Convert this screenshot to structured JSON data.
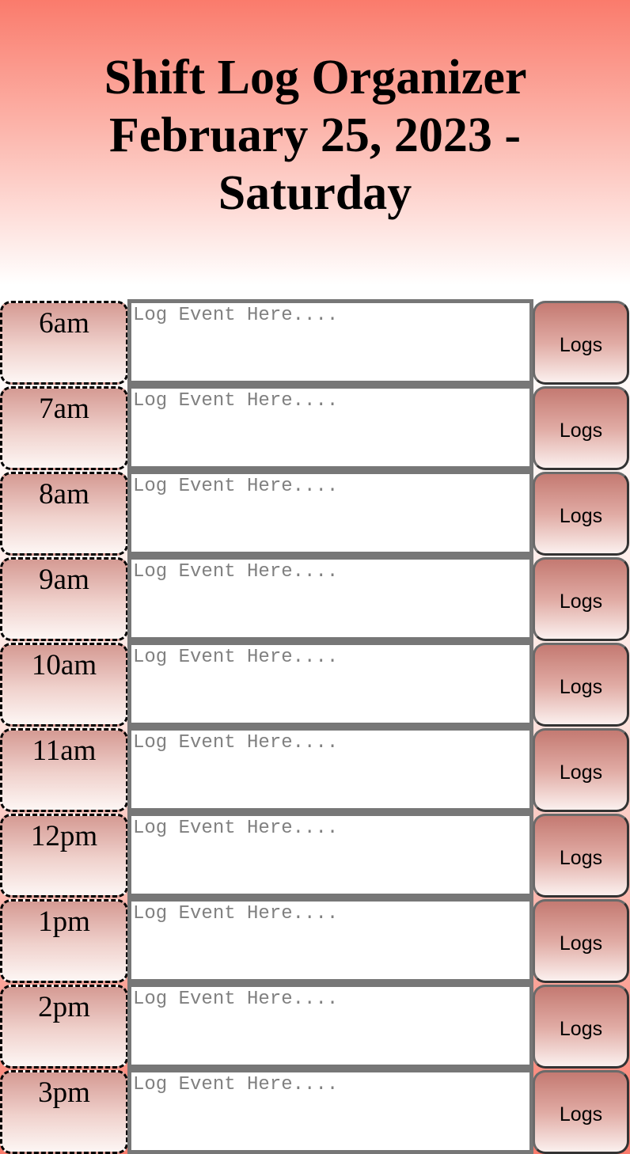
{
  "header": {
    "title": "Shift Log Organizer",
    "date": "February 25, 2023 - Saturday"
  },
  "rows": [
    {
      "hour": "6am",
      "placeholder": "Log Event Here....",
      "button": "Logs"
    },
    {
      "hour": "7am",
      "placeholder": "Log Event Here....",
      "button": "Logs"
    },
    {
      "hour": "8am",
      "placeholder": "Log Event Here....",
      "button": "Logs"
    },
    {
      "hour": "9am",
      "placeholder": "Log Event Here....",
      "button": "Logs"
    },
    {
      "hour": "10am",
      "placeholder": "Log Event Here....",
      "button": "Logs"
    },
    {
      "hour": "11am",
      "placeholder": "Log Event Here....",
      "button": "Logs"
    },
    {
      "hour": "12pm",
      "placeholder": "Log Event Here....",
      "button": "Logs"
    },
    {
      "hour": "1pm",
      "placeholder": "Log Event Here....",
      "button": "Logs"
    },
    {
      "hour": "2pm",
      "placeholder": "Log Event Here....",
      "button": "Logs"
    },
    {
      "hour": "3pm",
      "placeholder": "Log Event Here....",
      "button": "Logs"
    }
  ],
  "colors": {
    "accent": "#fa7b6c",
    "event_border": "#777777"
  }
}
